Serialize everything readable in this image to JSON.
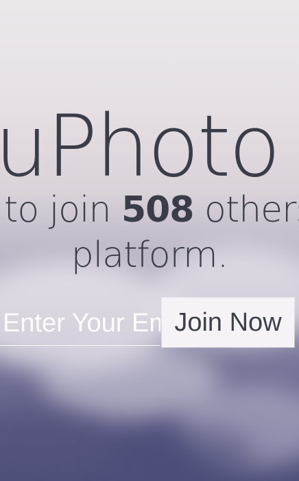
{
  "hero": {
    "brand": "uPhoto",
    "line1_before": "to join ",
    "line1_count": "508",
    "line1_after": " others",
    "line2": "platform."
  },
  "signup": {
    "email_placeholder": "Enter Your Email",
    "join_label": "Join Now"
  },
  "colors": {
    "text": "#3a3c48",
    "button_bg": "#f5f3f5",
    "input_text": "#ffffff"
  }
}
